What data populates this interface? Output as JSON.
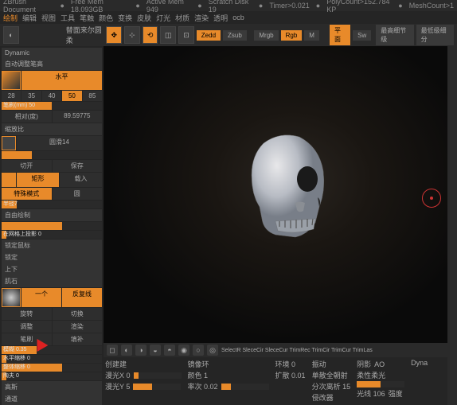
{
  "topbar": {
    "doc": "ZBrush Document",
    "freemem": "Free Mem 18.093GB",
    "activemem": "Active Mem 949",
    "scratch": "Scratch Disk 19",
    "timer": "Timer>0.021",
    "poly": "PolyCount>152.784 KP",
    "mesh": "MeshCount>1"
  },
  "menu": {
    "a": "绘制",
    "b": "编辑",
    "c": "视图",
    "d": "工具",
    "e": "笔触",
    "f": "颜色",
    "g": "变换",
    "h": "皮肤",
    "i": "灯光",
    "j": "材质",
    "k": "渲染",
    "l": "透明",
    "m": "ocb"
  },
  "toolbar": {
    "label": "替面来尔圆柔",
    "zadd": "Zedd",
    "zsub": "Zsub",
    "mrgb": "Mrgb",
    "rgb": "Rgb",
    "m": "M",
    "flat": "平面",
    "sw": "Sw",
    "a1": "最高细节级",
    "a2": "最低级细分"
  },
  "side": {
    "dynamic": "Dynamic",
    "autoadj": "自动调整笔高",
    "hrow": "水平",
    "nums": [
      "28",
      "35",
      "40",
      "50",
      "85"
    ],
    "scalemm": "笔刷(mm) 50",
    "angle": "相对(度)",
    "angleval": "89.59775",
    "resize": "缩放比",
    "roughness": "圆滑14",
    "alt": "切开",
    "save": "保存",
    "load": "载入",
    "rect": "矩形",
    "special": "特殊模式",
    "circle": "圆",
    "stroke": "半径7",
    "freehand": "自由绘制",
    "ongrid": "在网格上投影 0",
    "lazymouse": "锁定鼠标",
    "lazyradius": "锁定",
    "updown": "上下",
    "alpha": "肌石",
    "btn1": "一个",
    "btn2": "反复线",
    "rot": "旋转",
    "move": "切换",
    "adj": "调整",
    "render": "渲染",
    "fill": "填补",
    "size": "笔刷",
    "s1": "模糊 0.35",
    "s2": "水平缩移 0",
    "s3": "整体缩移 0",
    "s4": "陶夫 0",
    "gb": "高斯",
    "channel": "通道"
  },
  "bottom": {
    "tools": "SelectR SleceCir SleceCur TrimRec TrimCir TrimCur TrimLas",
    "create": "创建建",
    "mirror": "镜像环",
    "env": "环境 0",
    "vibr": "振动",
    "shad": "阴影",
    "ao": "AO",
    "sss": "单散全朝射",
    "wax": "柔性柔光",
    "dyn": "Dyna",
    "lightx": "漫光X 0",
    "lighty": "漫光Y 5",
    "color": "颜色 1",
    "rate": "率次 0.02",
    "dist": "分次离析 15",
    "ex": "扩散 0.01",
    "depth": "侵改器",
    "ray": "光线 106",
    "strength": "强度"
  }
}
